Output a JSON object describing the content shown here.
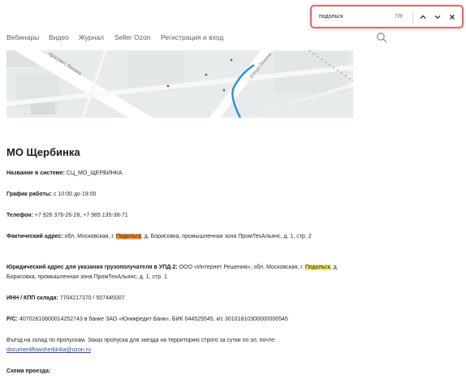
{
  "nav": {
    "items": [
      "Вебинары",
      "Видео",
      "Журнал",
      "Seller Ozon",
      "Регистрация и вход"
    ]
  },
  "find": {
    "query": "подольск",
    "count": "7/8"
  },
  "map": {
    "labels": [
      "проспект Ленина",
      "улица Ленина"
    ]
  },
  "page": {
    "title": "МО Щербинка"
  },
  "info": {
    "system_name_label": "Название в системе:",
    "system_name_value": " СЦ_МО_ЩЕРБИНКА",
    "schedule_label": "График работы:",
    "schedule_value": " с 10:00 до 19:00",
    "phone_label": "Телефон:",
    "phone_value": " +7 926 376-26-28, +7 985 135-38-71",
    "actual_address_label": "Фактический адрес:",
    "actual_address_pre": " обл. Московская, г. ",
    "actual_address_highlight": "Подольск",
    "actual_address_post": ", д. Борисовка, промышленная зона ПромТехАльянс, д. 1, стр. 2",
    "legal_address_label": "Юридический адрес для указания грузополучателя в УПД-2:",
    "legal_address_pre": " ООО «Интернет Решения», обл. Московская, г. ",
    "legal_address_highlight": "Подольск",
    "legal_address_post": ", д. Борисовка, промышленная зона ПромТехАльянс, д. 1, стр. 1",
    "inn_label": "ИНН / КПП склада:",
    "inn_value": " 7704217370 / 507445007",
    "account_label": "Р/С:",
    "account_value": " 40702810600014252743 в банке ЗАО «Юникредит Банк», БИК 044525545, к/с 30101810300000000545",
    "entry_text": "Въезд на склад по пропускам. Заказ пропуска для заезда на территорию строго за сутки по эл. почте:",
    "entry_email": "documentflowsherbinka@ozon.ru",
    "route_label": "Схема проезда:"
  }
}
